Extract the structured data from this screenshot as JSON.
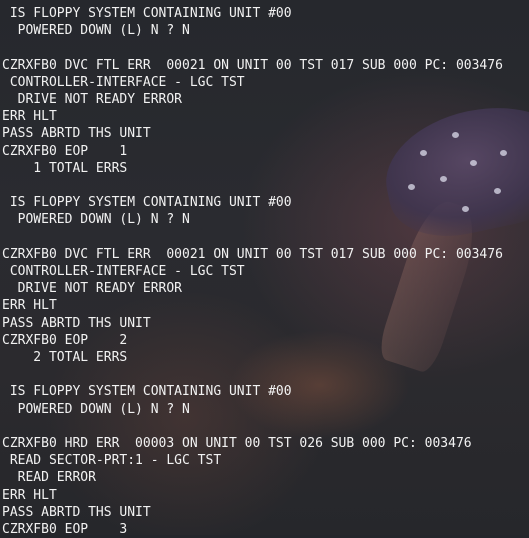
{
  "terminal": {
    "lines": [
      " IS FLOPPY SYSTEM CONTAINING UNIT #00",
      "  POWERED DOWN (L) N ? N",
      "",
      "CZRXFB0 DVC FTL ERR  00021 ON UNIT 00 TST 017 SUB 000 PC: 003476",
      " CONTROLLER-INTERFACE - LGC TST",
      "  DRIVE NOT READY ERROR",
      "ERR HLT",
      "PASS ABRTD THS UNIT",
      "CZRXFB0 EOP    1",
      "    1 TOTAL ERRS",
      "",
      " IS FLOPPY SYSTEM CONTAINING UNIT #00",
      "  POWERED DOWN (L) N ? N",
      "",
      "CZRXFB0 DVC FTL ERR  00021 ON UNIT 00 TST 017 SUB 000 PC: 003476",
      " CONTROLLER-INTERFACE - LGC TST",
      "  DRIVE NOT READY ERROR",
      "ERR HLT",
      "PASS ABRTD THS UNIT",
      "CZRXFB0 EOP    2",
      "    2 TOTAL ERRS",
      "",
      " IS FLOPPY SYSTEM CONTAINING UNIT #00",
      "  POWERED DOWN (L) N ? N",
      "",
      "CZRXFB0 HRD ERR  00003 ON UNIT 00 TST 026 SUB 000 PC: 003476",
      " READ SECTOR-PRT:1 - LGC TST",
      "  READ ERROR",
      "ERR HLT",
      "PASS ABRTD THS UNIT",
      "CZRXFB0 EOP    3"
    ]
  },
  "colors": {
    "text": "#f2f2f2",
    "background": "#24262b"
  }
}
